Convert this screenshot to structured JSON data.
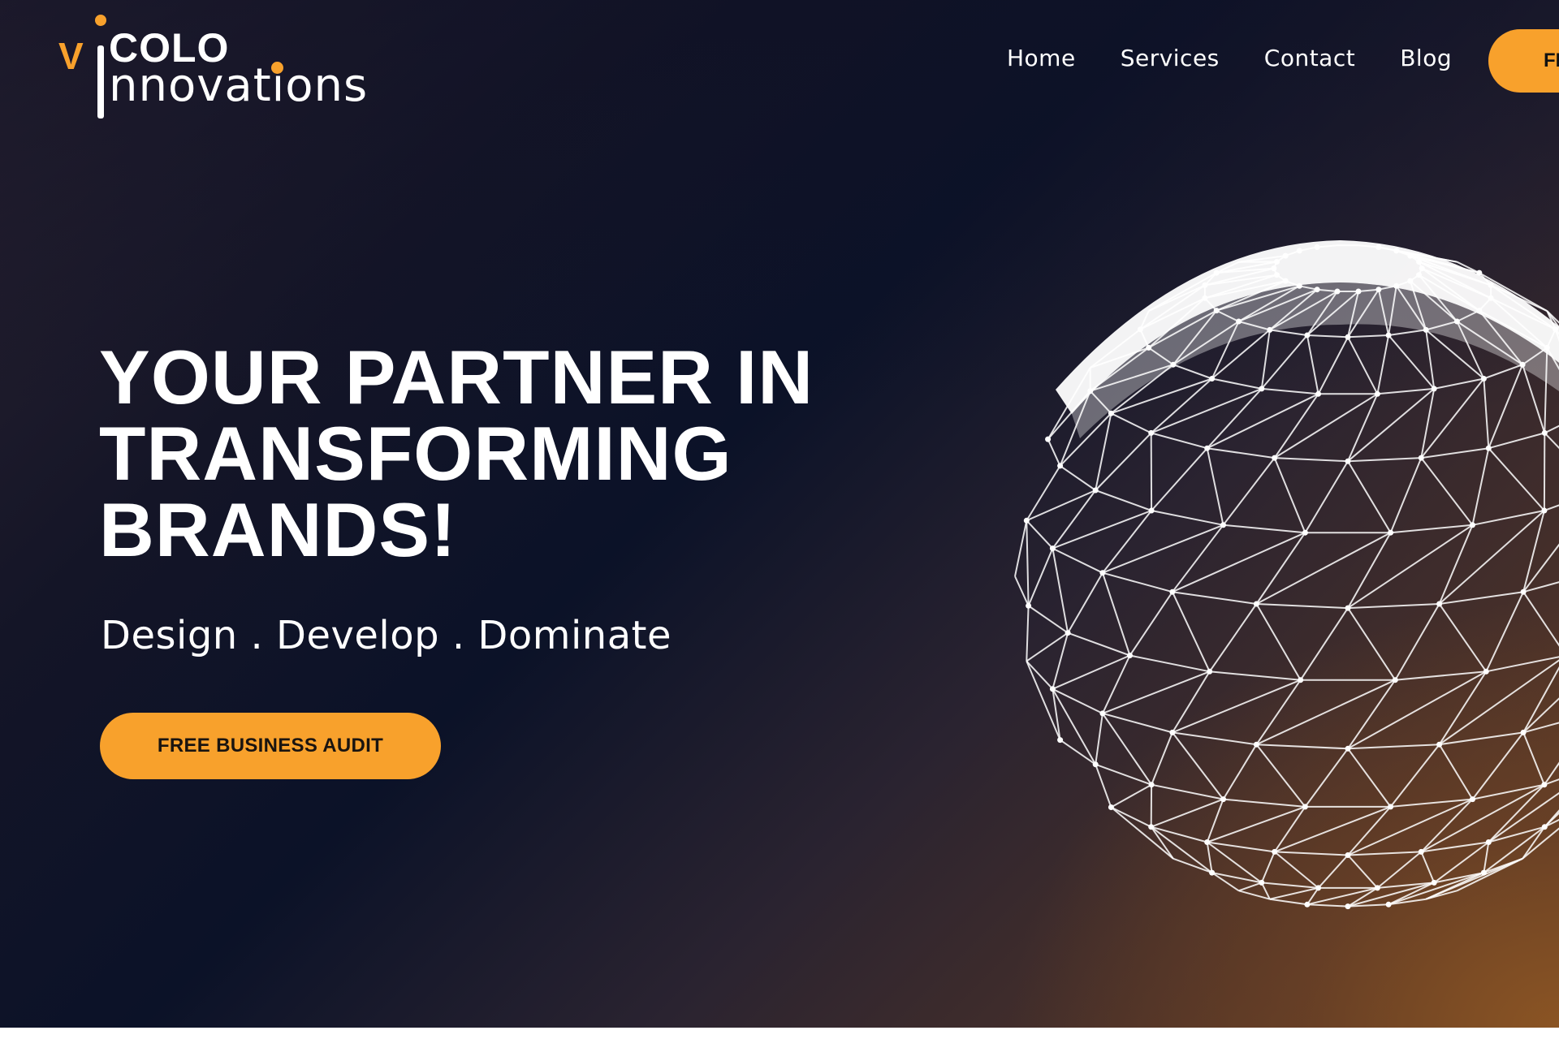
{
  "brand": {
    "logo_text": "vicolo innovations",
    "accent_color": "#F8A12C",
    "text_color": "#FFFFFF"
  },
  "nav": {
    "items": [
      {
        "label": "Home"
      },
      {
        "label": "Services"
      },
      {
        "label": "Contact"
      },
      {
        "label": "Blog"
      }
    ],
    "cta_label": "FI"
  },
  "hero": {
    "headline_lines": [
      "YOUR PARTNER IN",
      "TRANSFORMING",
      "BRANDS!"
    ],
    "tagline": "Design . Develop . Dominate",
    "cta_label": "FREE BUSINESS AUDIT",
    "graphic": "wireframe-sphere"
  }
}
